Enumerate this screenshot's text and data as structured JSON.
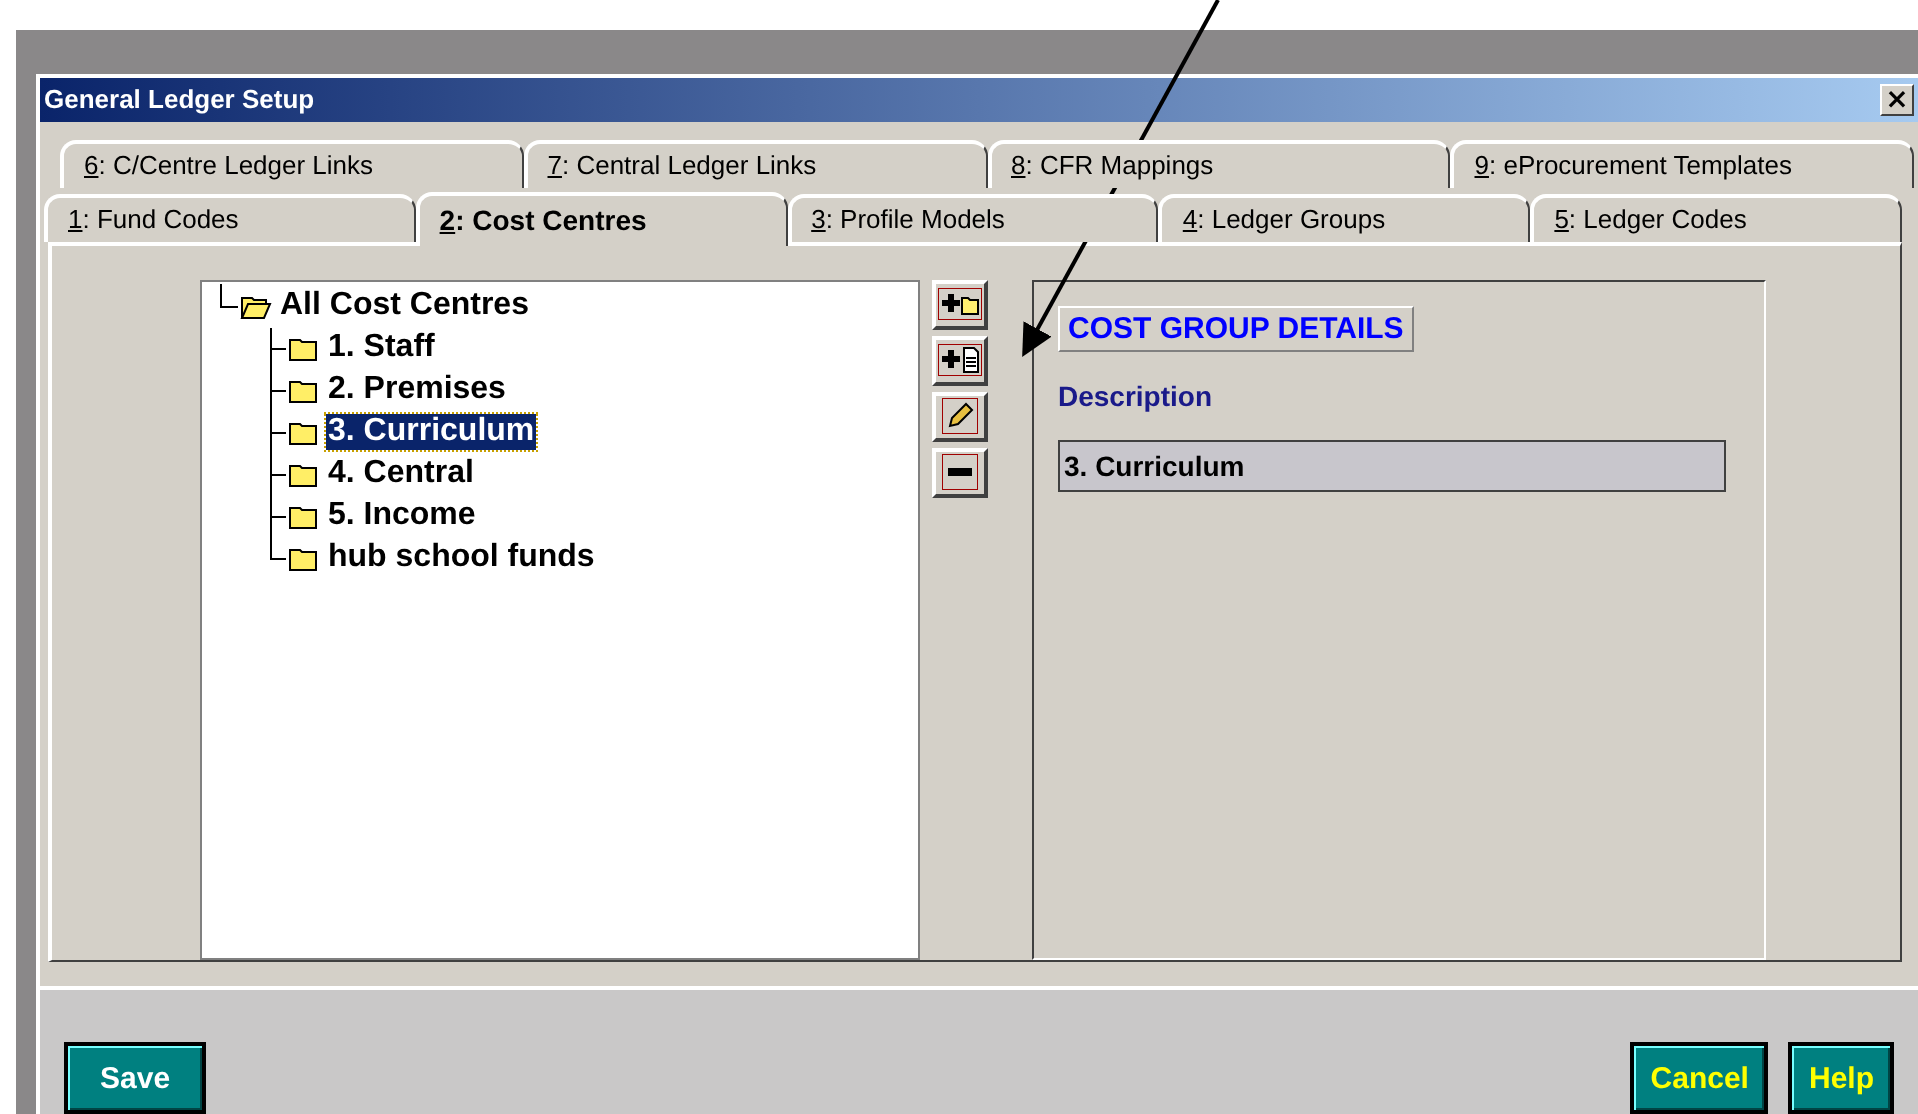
{
  "window": {
    "title": "General Ledger Setup",
    "close": "×"
  },
  "tab_rows": [
    {
      "tabs": [
        {
          "hotkey": "6",
          "label": ": C/Centre Ledger Links",
          "selected": false
        },
        {
          "hotkey": "7",
          "label": ": Central Ledger Links",
          "selected": false
        },
        {
          "hotkey": "8",
          "label": ": CFR Mappings",
          "selected": false
        },
        {
          "hotkey": "9",
          "label": ": eProcurement Templates",
          "selected": false
        }
      ]
    },
    {
      "tabs": [
        {
          "hotkey": "1",
          "label": ": Fund Codes",
          "selected": false
        },
        {
          "hotkey": "2",
          "label": ": Cost Centres",
          "selected": true
        },
        {
          "hotkey": "3",
          "label": ": Profile Models",
          "selected": false
        },
        {
          "hotkey": "4",
          "label": ": Ledger Groups",
          "selected": false
        },
        {
          "hotkey": "5",
          "label": ": Ledger Codes",
          "selected": false
        }
      ]
    }
  ],
  "tree": {
    "label": "All Cost Centres",
    "expanded": true,
    "selected": false,
    "children": [
      {
        "label": "1. Staff",
        "selected": false
      },
      {
        "label": "2. Premises",
        "selected": false
      },
      {
        "label": "3. Curriculum",
        "selected": true
      },
      {
        "label": "4. Central",
        "selected": false
      },
      {
        "label": "5. Income",
        "selected": false
      },
      {
        "label": "hub school funds",
        "selected": false
      }
    ]
  },
  "tools": [
    {
      "kind": "add-folder"
    },
    {
      "kind": "add-document"
    },
    {
      "kind": "edit"
    },
    {
      "kind": "remove"
    }
  ],
  "details": {
    "heading": "COST GROUP DETAILS",
    "field_label": "Description",
    "value": "3. Curriculum"
  },
  "buttons_left": [
    "Save"
  ],
  "buttons_right": [
    "Cancel",
    "Help"
  ]
}
